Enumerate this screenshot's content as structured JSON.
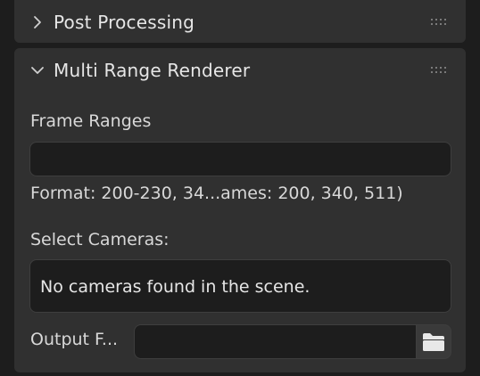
{
  "panels": {
    "post_processing": {
      "title": "Post Processing",
      "expanded": false
    },
    "multi_range": {
      "title": "Multi Range Renderer",
      "expanded": true,
      "frame_ranges_label": "Frame Ranges",
      "frame_ranges_value": "",
      "format_hint": "Format: 200-230, 34...ames: 200, 340, 511)",
      "select_cameras_label": "Select Cameras:",
      "cameras_message": "No cameras found in the scene.",
      "output_label": "Output F...",
      "output_value": ""
    }
  },
  "icons": {
    "collapsed": "chevron-right-icon",
    "expanded": "chevron-down-icon",
    "drag": "drag-handle-icon",
    "folder": "folder-icon"
  },
  "colors": {
    "background": "#1d1d1d",
    "panel": "#303030",
    "field": "#1d1d1d",
    "text": "#e6e6e6"
  }
}
